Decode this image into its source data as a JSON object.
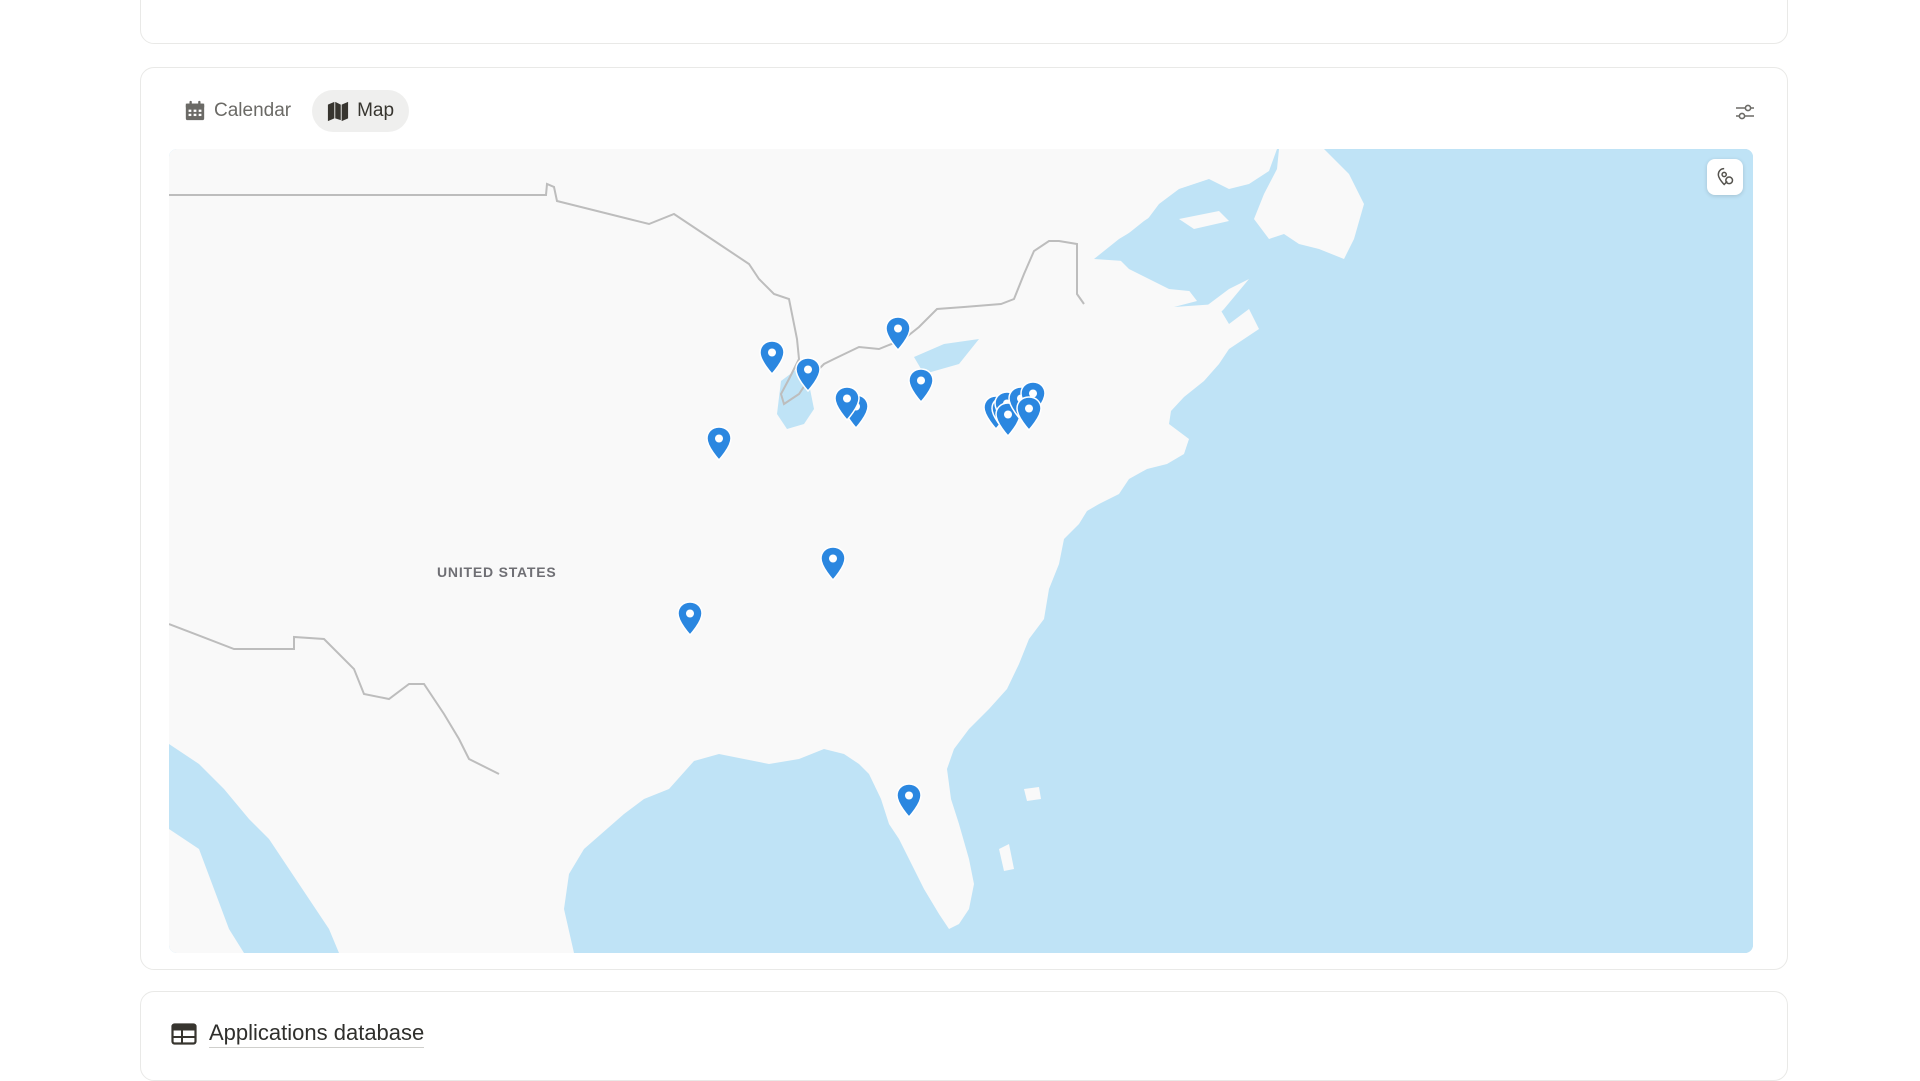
{
  "views": {
    "tabs": [
      {
        "label": "Calendar",
        "icon": "calendar-icon",
        "active": false
      },
      {
        "label": "Map",
        "icon": "map-icon",
        "active": true
      }
    ]
  },
  "map": {
    "country_label": "UNITED STATES",
    "land_color": "#f9f9f9",
    "water_color": "#bfe3f6",
    "pin_color": "#2b87e0",
    "pin_count": 17
  },
  "database": {
    "title": "Applications database",
    "icon": "table-icon"
  }
}
